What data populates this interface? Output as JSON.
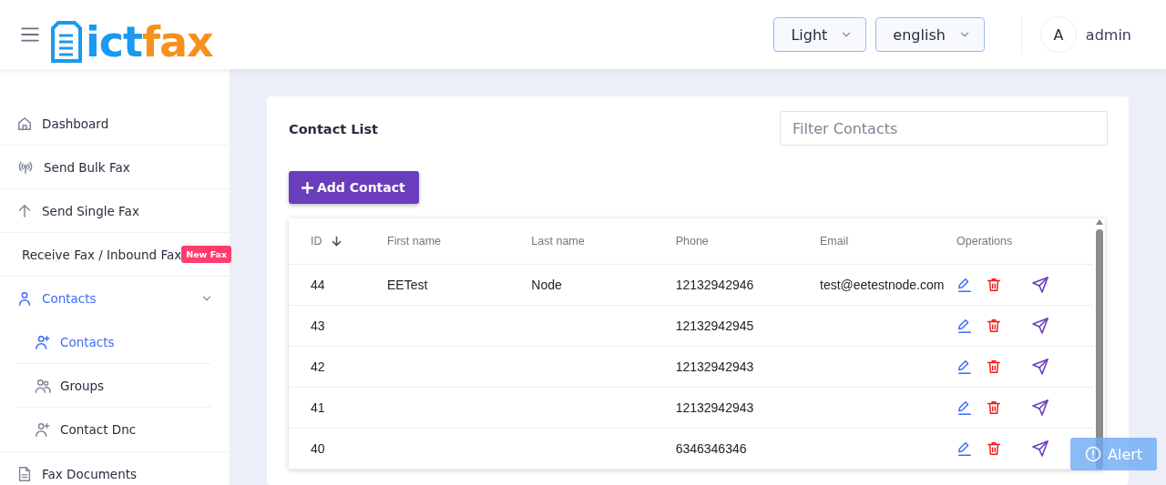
{
  "header": {
    "logo": [
      {
        "text": "ict",
        "color": "#1a9af0"
      },
      {
        "text": "fax",
        "color": "#f7901e"
      }
    ],
    "theme_select": {
      "value": "Light"
    },
    "language_select": {
      "value": "english"
    },
    "user": {
      "avatar": "A",
      "name": "admin"
    }
  },
  "sidebar": {
    "items": [
      {
        "label": "Dashboard",
        "selected": false
      },
      {
        "label": "Send Bulk Fax",
        "selected": false
      },
      {
        "label": "Send Single Fax",
        "selected": false
      },
      {
        "label": "Receive Fax / Inbound Fax",
        "selected": false,
        "badge": "New Fax"
      },
      {
        "label": "Contacts",
        "selected": true,
        "expanded": true,
        "children": [
          {
            "label": "Contacts",
            "selected": true
          },
          {
            "label": "Groups",
            "selected": false
          },
          {
            "label": "Contact Dnc",
            "selected": false
          }
        ]
      },
      {
        "label": "Fax Documents",
        "selected": false
      }
    ]
  },
  "card": {
    "title": "Contact List",
    "filter": {
      "placeholder": "Filter Contacts"
    },
    "add_button": "Add Contact",
    "table": {
      "columns": [
        {
          "label": "ID",
          "sort_descending": true
        },
        {
          "label": "First name"
        },
        {
          "label": "Last name"
        },
        {
          "label": "Phone"
        },
        {
          "label": "Email"
        },
        {
          "label": "Operations"
        }
      ],
      "rows": [
        {
          "id": "44",
          "first_name": "EETest",
          "last_name": "Node",
          "phone": "12132942946",
          "email": "test@eetestnode.com"
        },
        {
          "id": "43",
          "phone": "12132942945"
        },
        {
          "id": "42",
          "phone": "12132942943"
        },
        {
          "id": "41",
          "phone": "12132942943"
        },
        {
          "id": "40",
          "phone": "6346346346"
        }
      ]
    }
  },
  "alert_button": "Alert"
}
